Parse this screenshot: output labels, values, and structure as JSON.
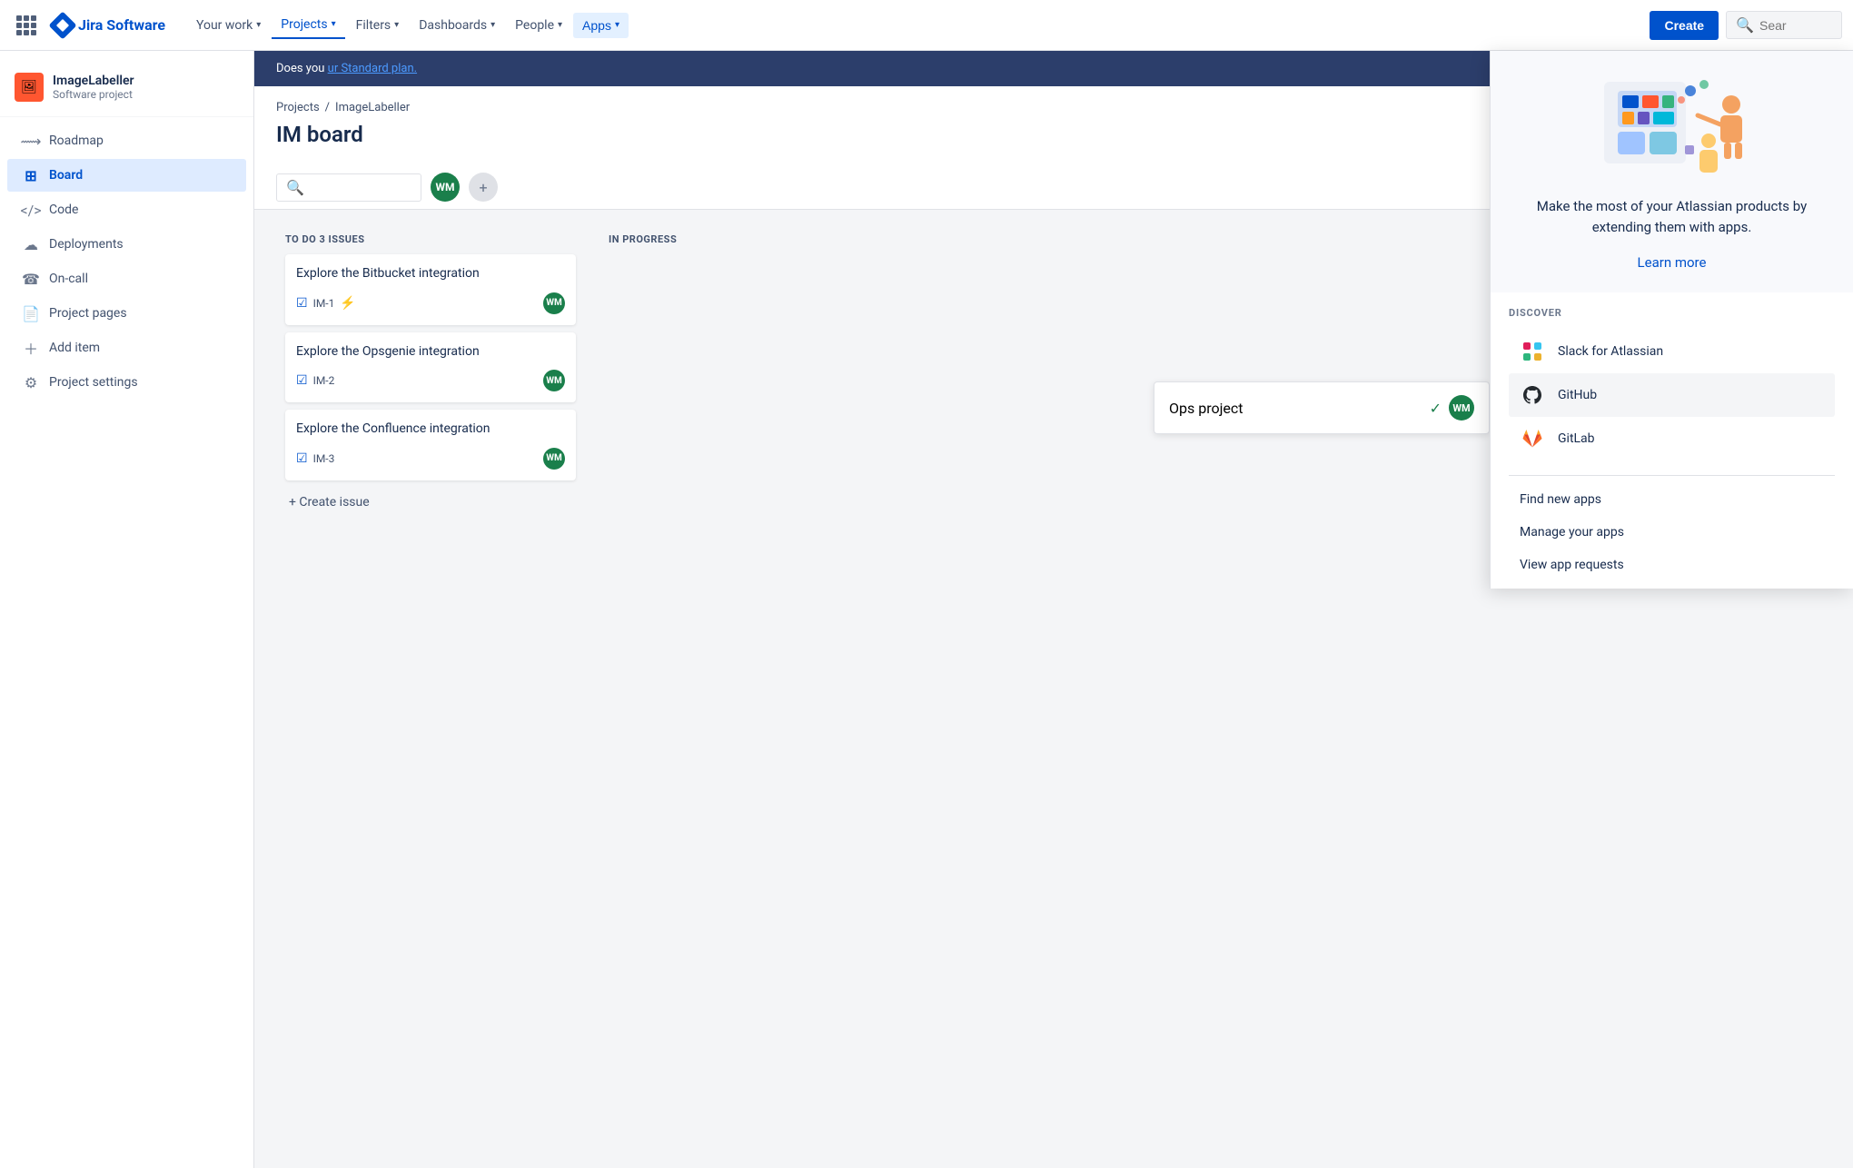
{
  "topnav": {
    "logo_text": "Jira Software",
    "nav_items": [
      {
        "label": "Your work",
        "has_chevron": true,
        "active": false
      },
      {
        "label": "Projects",
        "has_chevron": true,
        "active": true
      },
      {
        "label": "Filters",
        "has_chevron": true,
        "active": false
      },
      {
        "label": "Dashboards",
        "has_chevron": true,
        "active": false
      },
      {
        "label": "People",
        "has_chevron": true,
        "active": false
      },
      {
        "label": "Apps",
        "has_chevron": true,
        "active": true,
        "highlighted": true
      }
    ],
    "create_label": "Create",
    "search_placeholder": "Sear"
  },
  "sidebar": {
    "project_name": "ImageLabeller",
    "project_type": "Software project",
    "items": [
      {
        "label": "Roadmap",
        "icon": "roadmap"
      },
      {
        "label": "Board",
        "icon": "board",
        "active": true
      },
      {
        "label": "Code",
        "icon": "code"
      },
      {
        "label": "Deployments",
        "icon": "deployments"
      },
      {
        "label": "On-call",
        "icon": "oncall"
      },
      {
        "label": "Project pages",
        "icon": "pages"
      },
      {
        "label": "Add item",
        "icon": "add"
      },
      {
        "label": "Project settings",
        "icon": "settings"
      }
    ]
  },
  "banner": {
    "text": "Does you",
    "suffix": "ur Standard plan."
  },
  "board": {
    "breadcrumb_projects": "Projects",
    "breadcrumb_separator": "/",
    "breadcrumb_project": "ImageLabeller",
    "title": "IM board",
    "columns": [
      {
        "header": "TO DO 3 ISSUES",
        "cards": [
          {
            "title": "Explore the Bitbucket integration",
            "id": "IM-1",
            "has_link_icon": true,
            "assignee": "WM"
          },
          {
            "title": "Explore the Opsgenie integration",
            "id": "IM-2",
            "has_link_icon": false,
            "assignee": "WM"
          },
          {
            "title": "Explore the Confluence integration",
            "id": "IM-3",
            "has_link_icon": false,
            "assignee": "WM"
          }
        ],
        "create_label": "+ Create issue"
      },
      {
        "header": "IN PROGRESS",
        "cards": [],
        "create_label": ""
      }
    ]
  },
  "apps_dropdown": {
    "tagline": "Make the most of your Atlassian products by extending them with apps.",
    "learn_more": "Learn more",
    "discover_label": "DISCOVER",
    "discover_items": [
      {
        "label": "Slack for Atlassian",
        "icon": "slack"
      },
      {
        "label": "GitHub",
        "icon": "github",
        "highlighted": true
      },
      {
        "label": "GitLab",
        "icon": "gitlab"
      }
    ],
    "links": [
      {
        "label": "Find new apps"
      },
      {
        "label": "Manage your apps"
      },
      {
        "label": "View app requests"
      }
    ]
  },
  "right_panel": {
    "text": "Ops project",
    "assignee": "WM"
  }
}
